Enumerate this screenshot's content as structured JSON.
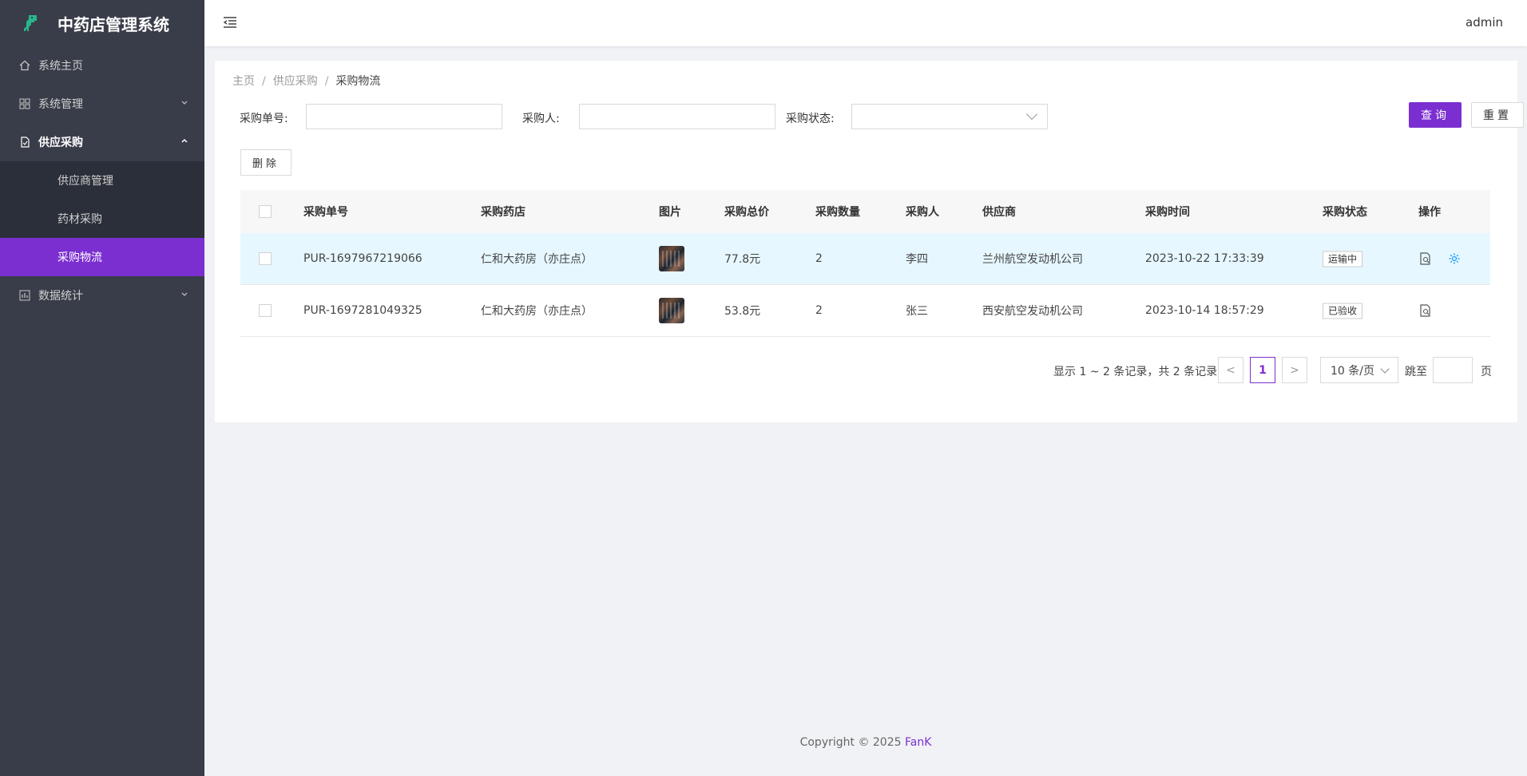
{
  "app": {
    "title": "中药店管理系统"
  },
  "sidebar": {
    "items": [
      {
        "label": "系统主页",
        "icon": "home-icon"
      },
      {
        "label": "系统管理",
        "icon": "grid-icon"
      },
      {
        "label": "供应采购",
        "icon": "document-icon"
      },
      {
        "label": "数据统计",
        "icon": "chart-icon"
      }
    ],
    "subitems": [
      {
        "label": "供应商管理"
      },
      {
        "label": "药材采购"
      },
      {
        "label": "采购物流"
      }
    ]
  },
  "header": {
    "user": "admin"
  },
  "breadcrumb": [
    "主页",
    "供应采购",
    "采购物流"
  ],
  "search": {
    "order_label": "采购单号:",
    "buyer_label": "采购人:",
    "status_label": "采购状态:",
    "order_value": "",
    "buyer_value": "",
    "status_value": "",
    "query_label": "查询",
    "reset_label": "重置"
  },
  "actions": {
    "delete_label": "删除"
  },
  "table": {
    "columns": [
      "采购单号",
      "采购药店",
      "图片",
      "采购总价",
      "采购数量",
      "采购人",
      "供应商",
      "采购时间",
      "采购状态",
      "操作"
    ],
    "rows": [
      {
        "order": "PUR-1697967219066",
        "store": "仁和大药房（亦庄点）",
        "total": "77.8元",
        "qty": "2",
        "buyer": "李四",
        "supplier": "兰州航空发动机公司",
        "time": "2023-10-22 17:33:39",
        "status": "运输中"
      },
      {
        "order": "PUR-1697281049325",
        "store": "仁和大药房（亦庄点）",
        "total": "53.8元",
        "qty": "2",
        "buyer": "张三",
        "supplier": "西安航空发动机公司",
        "time": "2023-10-14 18:57:29",
        "status": "已验收"
      }
    ]
  },
  "pager": {
    "info": "显示 1 ~ 2 条记录，共 2 条记录",
    "current": "1",
    "prev": "<",
    "next": ">",
    "size": "10 条/页",
    "jump_label": "跳至",
    "page_label": "页"
  },
  "footer": {
    "copyright": "Copyright © 2025",
    "author": "FanK"
  },
  "colors": {
    "accent": "#7b2fd1",
    "sidebar": "#393d49",
    "row_highlight": "#e6f7ff"
  }
}
